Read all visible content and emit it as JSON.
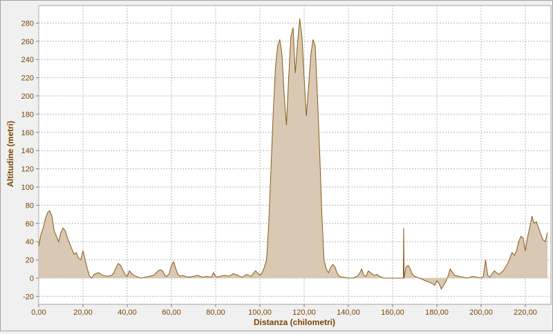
{
  "chart_data": {
    "type": "area",
    "title": "",
    "xlabel": "Distanza (chilometri)",
    "ylabel": "Altitudine (metri)",
    "xlim": [
      0,
      230
    ],
    "ylim": [
      -20,
      290
    ],
    "x_ticks": [
      "0,00",
      "20,00",
      "40,00",
      "60,00",
      "80,00",
      "100,00",
      "120,00",
      "140,00",
      "160,00",
      "180,00",
      "200,00",
      "220,00"
    ],
    "y_ticks": [
      "-20",
      "0",
      "20",
      "40",
      "60",
      "80",
      "100",
      "120",
      "140",
      "160",
      "180",
      "200",
      "220",
      "240",
      "260",
      "280"
    ],
    "grid": true,
    "colors": {
      "fill": "#d8c8b4",
      "line": "#8a5a12",
      "label": "#7a4400"
    },
    "series": [
      {
        "x": [
          0,
          1,
          2,
          3,
          4,
          5,
          6,
          7,
          8,
          9,
          10,
          11,
          12,
          13,
          14,
          15,
          16,
          17,
          18,
          19,
          20,
          21,
          22,
          23,
          24,
          25,
          27,
          29,
          31,
          33,
          34,
          35,
          36,
          37,
          38,
          39,
          40,
          41,
          42,
          43,
          44,
          46,
          48,
          50,
          52,
          54,
          55,
          56,
          57,
          58,
          59,
          60,
          61,
          62,
          63,
          64,
          65,
          66,
          68,
          70,
          72,
          74,
          76,
          78,
          79,
          80,
          81,
          82,
          84,
          86,
          88,
          90,
          92,
          94,
          96,
          98,
          100,
          101,
          102,
          103,
          104,
          105,
          106,
          107,
          108,
          109,
          110,
          111,
          112,
          113,
          114,
          115,
          116,
          117,
          118,
          119,
          120,
          121,
          122,
          123,
          124,
          125,
          126,
          127,
          128,
          129,
          130,
          131,
          132,
          133,
          134,
          135,
          136,
          137,
          138,
          140,
          142,
          144,
          145,
          146,
          147,
          148,
          149,
          150,
          151,
          152,
          153,
          154,
          155,
          156,
          158,
          160,
          162,
          164,
          164.8,
          165,
          165.2,
          166,
          167,
          168,
          169,
          170,
          171,
          172,
          174,
          176,
          178,
          179,
          180,
          181,
          182,
          183,
          184,
          185,
          186,
          188,
          190,
          192,
          194,
          196,
          198,
          200,
          201,
          202,
          203,
          204,
          205,
          206,
          208,
          210,
          212,
          213,
          214,
          215,
          216,
          217,
          218,
          219,
          220,
          221,
          222,
          223,
          224,
          225,
          226,
          227,
          228,
          229,
          230
        ],
        "y": [
          35,
          48,
          55,
          65,
          72,
          74,
          68,
          52,
          46,
          40,
          50,
          55,
          52,
          44,
          38,
          32,
          26,
          28,
          22,
          20,
          30,
          20,
          10,
          2,
          0,
          4,
          6,
          3,
          2,
          3,
          6,
          12,
          16,
          14,
          9,
          4,
          2,
          8,
          5,
          3,
          2,
          0,
          1,
          2,
          3,
          8,
          9,
          8,
          3,
          2,
          5,
          14,
          18,
          10,
          4,
          2,
          3,
          2,
          1,
          2,
          3,
          1,
          2,
          1,
          6,
          2,
          1,
          2,
          3,
          2,
          5,
          3,
          1,
          4,
          2,
          8,
          3,
          6,
          12,
          20,
          60,
          120,
          180,
          230,
          255,
          262,
          245,
          200,
          168,
          220,
          265,
          275,
          225,
          258,
          285,
          265,
          220,
          178,
          210,
          245,
          262,
          255,
          200,
          140,
          70,
          20,
          10,
          6,
          12,
          15,
          12,
          5,
          2,
          1,
          1,
          0,
          0,
          2,
          5,
          10,
          3,
          2,
          8,
          6,
          4,
          3,
          4,
          2,
          1,
          0,
          0,
          0,
          0,
          0,
          0,
          55,
          0,
          12,
          14,
          10,
          4,
          2,
          1,
          0,
          -2,
          -4,
          -6,
          -8,
          -3,
          -6,
          -12,
          -8,
          -4,
          2,
          10,
          3,
          2,
          1,
          0,
          2,
          1,
          0,
          2,
          20,
          3,
          1,
          5,
          8,
          4,
          8,
          16,
          22,
          28,
          25,
          30,
          40,
          46,
          44,
          30,
          45,
          56,
          68,
          60,
          62,
          55,
          48,
          42,
          40,
          50
        ]
      }
    ]
  }
}
